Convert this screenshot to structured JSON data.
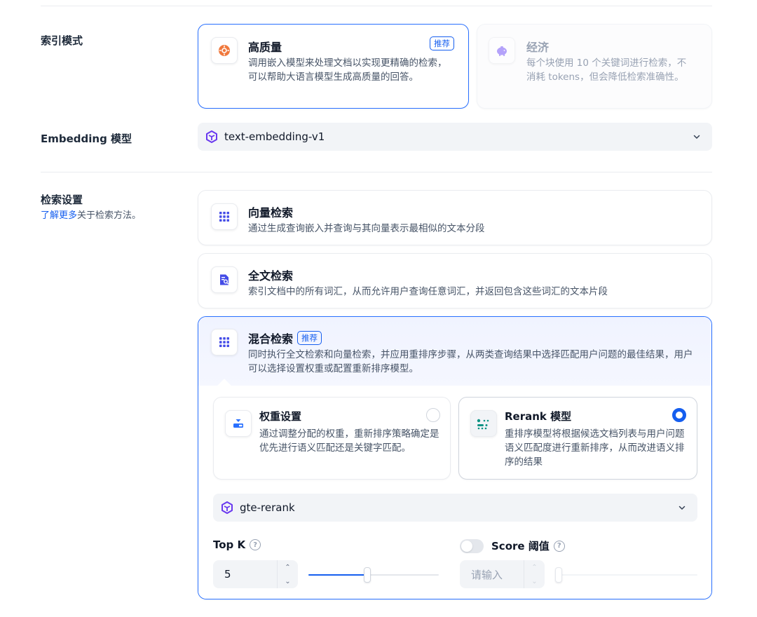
{
  "index_mode": {
    "label": "索引模式",
    "options": [
      {
        "title": "高质量",
        "badge": "推荐",
        "desc": "调用嵌入模型来处理文档以实现更精确的检索，可以帮助大语言模型生成高质量的回答。",
        "selected": true
      },
      {
        "title": "经济",
        "desc": "每个块使用 10 个关键词进行检索，不消耗 tokens，但会降低检索准确性。",
        "disabled": true
      }
    ]
  },
  "embedding": {
    "label": "Embedding 模型",
    "value": "text-embedding-v1"
  },
  "retrieval": {
    "label": "检索设置",
    "learn_more": "了解更多",
    "learn_more_suffix": "关于检索方法。",
    "methods": [
      {
        "title": "向量检索",
        "desc": "通过生成查询嵌入并查询与其向量表示最相似的文本分段"
      },
      {
        "title": "全文检索",
        "desc": "索引文档中的所有词汇，从而允许用户查询任意词汇，并返回包含这些词汇的文本片段"
      },
      {
        "title": "混合检索",
        "badge": "推荐",
        "desc": "同时执行全文检索和向量检索，并应用重排序步骤，从两类查询结果中选择匹配用户问题的最佳结果，用户可以选择设置权重或配置重新排序模型。",
        "selected": true
      }
    ],
    "hybrid": {
      "weight": {
        "title": "权重设置",
        "desc": "通过调整分配的权重，重新排序策略确定是优先进行语义匹配还是关键字匹配。",
        "selected": false
      },
      "rerank": {
        "title": "Rerank 模型",
        "desc": "重排序模型将根据候选文档列表与用户问题语义匹配度进行重新排序，从而改进语义排序的结果",
        "selected": true
      },
      "rerank_model": "gte-rerank",
      "top_k": {
        "label": "Top K",
        "value": "5",
        "slider_fraction": 0.45
      },
      "score": {
        "label": "Score 阈值",
        "placeholder": "请输入",
        "enabled": false,
        "slider_fraction": 0.0
      }
    }
  },
  "colors": {
    "accent": "#155eef",
    "selected_border": "#2970ff",
    "hybrid_header_bg": "#eff4ff"
  },
  "icons": [
    "sun-icon",
    "piggy-bank-icon",
    "model-logo-icon",
    "grid-dots-icon",
    "doc-search-icon",
    "weight-icon",
    "rerank-icon",
    "chevron-down-icon",
    "help-icon"
  ]
}
